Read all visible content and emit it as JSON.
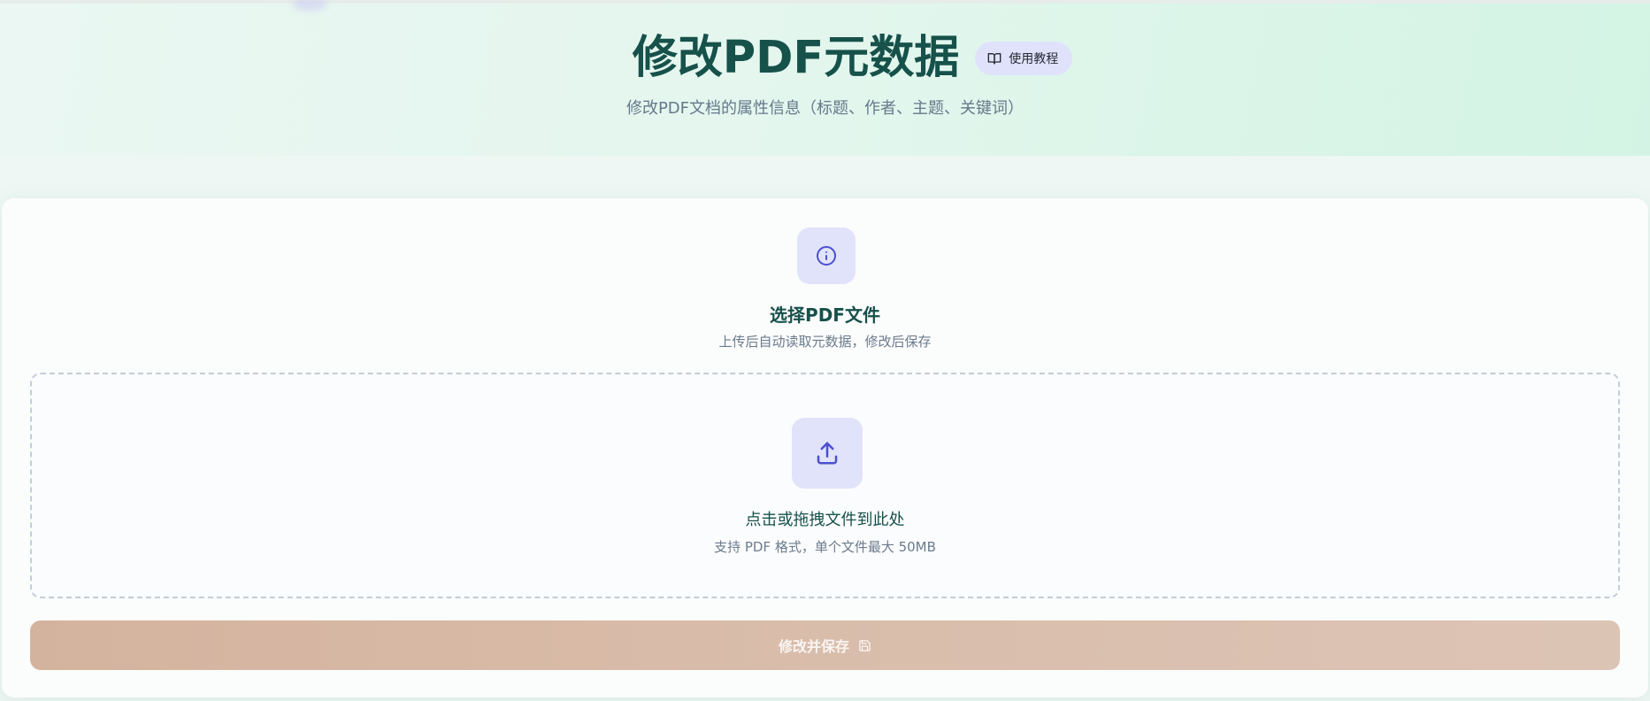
{
  "header": {
    "title": "修改PDF元数据",
    "tutorial_label": "使用教程",
    "subtitle": "修改PDF文档的属性信息（标题、作者、主题、关键词）"
  },
  "card": {
    "title": "选择PDF文件",
    "description": "上传后自动读取元数据，修改后保存"
  },
  "dropzone": {
    "primary_text": "点击或拖拽文件到此处",
    "hint_text": "支持 PDF 格式，单个文件最大 50MB"
  },
  "submit": {
    "label": "修改并保存"
  },
  "colors": {
    "brand_dark": "#16514a",
    "accent_lavender": "#e1e3fb",
    "icon_indigo": "#4a4fd1",
    "button_tan": "#d4b39e"
  },
  "icons": {
    "tutorial": "book-open-icon",
    "info": "info-icon",
    "upload": "upload-icon",
    "save": "save-icon"
  }
}
